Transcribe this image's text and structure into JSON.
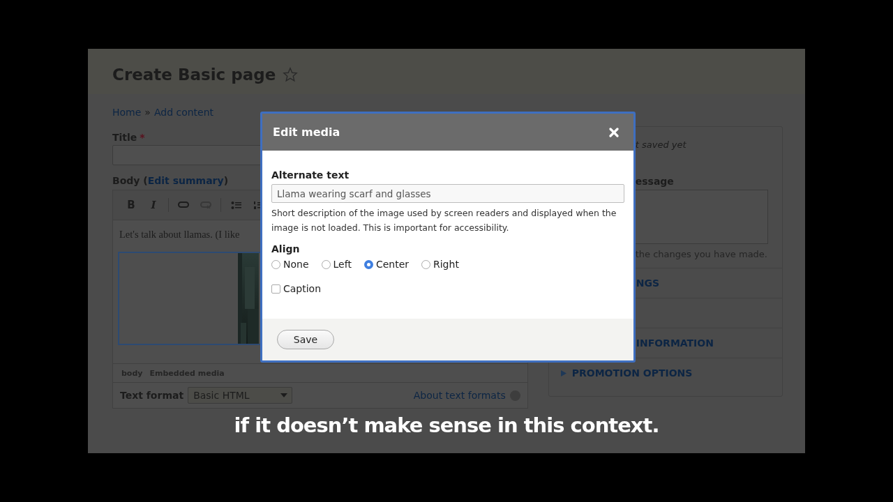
{
  "page": {
    "title": "Create Basic page",
    "breadcrumb": {
      "items": [
        "Home",
        "Add content"
      ],
      "separator": "»"
    },
    "title_field": {
      "label": "Title",
      "required_mark": "*"
    },
    "body_field": {
      "label_before": "Body (",
      "link": "Edit summary",
      "label_after": ")"
    },
    "toolbar": [
      {
        "kind": "bold",
        "label": "B",
        "disabled": false
      },
      {
        "kind": "italic",
        "label": "I",
        "disabled": false
      },
      {
        "kind": "link",
        "disabled": false
      },
      {
        "kind": "unlink",
        "disabled": true
      },
      {
        "kind": "bullets",
        "disabled": false
      },
      {
        "kind": "numbers",
        "disabled": false
      }
    ],
    "editor_text": "Let's talk about llamas. (I like",
    "editor_image": {
      "kind": "picture"
    },
    "element_path": [
      "body",
      "Embedded media"
    ],
    "text_format": {
      "label": "Text format",
      "value": "Basic HTML",
      "help_link": "About text formats"
    },
    "sidebar": {
      "status": "t saved yet",
      "log_label": "essage",
      "log_hint": "the changes you have made.",
      "sections": [
        {
          "label": "NGS"
        },
        {
          "label": "INFORMATION"
        },
        {
          "label": "PROMOTION OPTIONS",
          "arrow_visible": true
        }
      ]
    }
  },
  "dialog": {
    "title": "Edit media",
    "alt_text": {
      "label": "Alternate text",
      "value": "Llama wearing scarf and glasses",
      "description": "Short description of the image used by screen readers and displayed when the image is not loaded. This is important for accessibility."
    },
    "align": {
      "label": "Align",
      "options": [
        {
          "label": "None",
          "selected": false
        },
        {
          "label": "Left",
          "selected": false
        },
        {
          "label": "Center",
          "selected": true
        },
        {
          "label": "Right",
          "selected": false
        }
      ]
    },
    "caption": {
      "label": "Caption",
      "checked": false
    },
    "save": "Save"
  },
  "subtitle": "if it doesn’t make sense in this context."
}
